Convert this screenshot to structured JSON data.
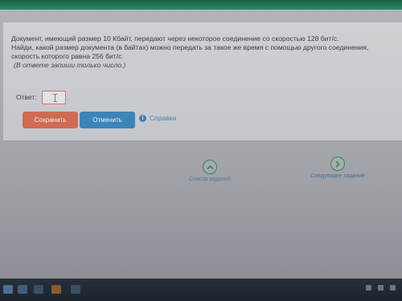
{
  "question": {
    "line1": "Документ, имеющий размер 10 Кбайт, передают через некоторое соединение со скоростью 128 бит/с.",
    "line2": "Найди, какой размер документа (в байтах) можно передать за такое же время с помощью другого соединения,",
    "line3": "скорость которого равна 256 бит/с.",
    "hint": "(В ответе запиши только число.)"
  },
  "answer": {
    "label": "Ответ:",
    "value": "",
    "suffix": "."
  },
  "buttons": {
    "save": "Сохранить",
    "cancel": "Отменить",
    "help": "Справка"
  },
  "navigation": {
    "list_label": "Список заданий",
    "next_label": "Следующее задание"
  },
  "colors": {
    "save": "#cf6b52",
    "cancel": "#3d84b8",
    "link": "#3f7fb4"
  }
}
